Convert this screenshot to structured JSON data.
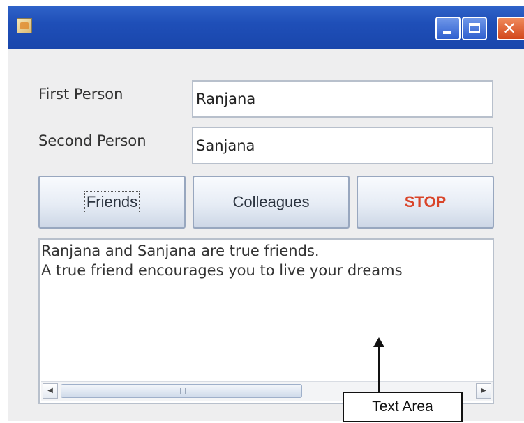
{
  "window": {
    "title": "",
    "icons": {
      "app": "java-app-icon",
      "minimize": "minimize-icon",
      "maximize": "maximize-icon",
      "close": "close-icon"
    }
  },
  "form": {
    "first_person_label": "First Person",
    "first_person_value": "Ranjana",
    "second_person_label": "Second Person",
    "second_person_value": "Sanjana"
  },
  "buttons": {
    "friends": "Friends",
    "colleagues": "Colleagues",
    "stop": "STOP"
  },
  "colors": {
    "stop_text": "#d9452a",
    "titlebar": "#1f4fb8",
    "close_button": "#d2471c"
  },
  "text_area": {
    "lines": [
      "Ranjana and Sanjana are true friends.",
      "A true friend encourages you to live your dreams"
    ]
  },
  "annotation": {
    "label": "Text Area"
  }
}
